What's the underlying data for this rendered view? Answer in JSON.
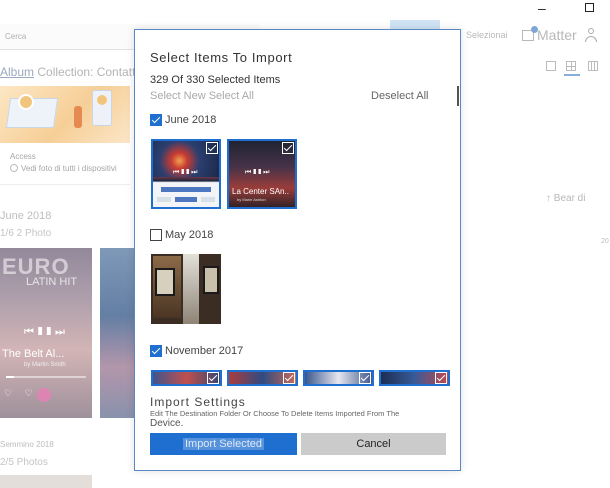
{
  "background": {
    "search_placeholder": "Cerca",
    "toolbar_text": "Selezionai",
    "brand": "Matter",
    "breadcrumb_link": "Album",
    "breadcrumb_rest": " Collection: Contatt",
    "access_label": "Access",
    "access_link": "Vedi foto di tutti i dispositivi",
    "group1_date": "June 2018",
    "group1_count": "1/6 2 Photo",
    "music_title": "The Belt Al...",
    "music_big": "EURO",
    "music_sub": "LATIN HIT",
    "music_artist": "by Martin Smith",
    "group2_date": "Semmino 2018",
    "group2_count": "2/5 Photos",
    "side_label": "Bear",
    "side_number": "20",
    "colors": {
      "accent": "#1e6fd0",
      "dialog_border": "#5b87c4"
    }
  },
  "dialog": {
    "title": "Select Items To Import",
    "count": "329 Of 330 Selected Items",
    "select_new": "Select New Select All",
    "deselect": "Deselect All",
    "groups": [
      {
        "label": "June 2018",
        "checked": true
      },
      {
        "label": "May 2018",
        "checked": false
      },
      {
        "label": "November 2017",
        "checked": true
      }
    ],
    "thumb2_label": "La Center SAn..",
    "thumb2_artist": "by Marie Ashton",
    "settings_title": "Import Settings",
    "settings_desc": "Edit The Destination Folder Or Choose To Delete Items Imported From The",
    "settings_device": "Device.",
    "import_button": "Import Selected",
    "cancel_button": "Cancel"
  }
}
